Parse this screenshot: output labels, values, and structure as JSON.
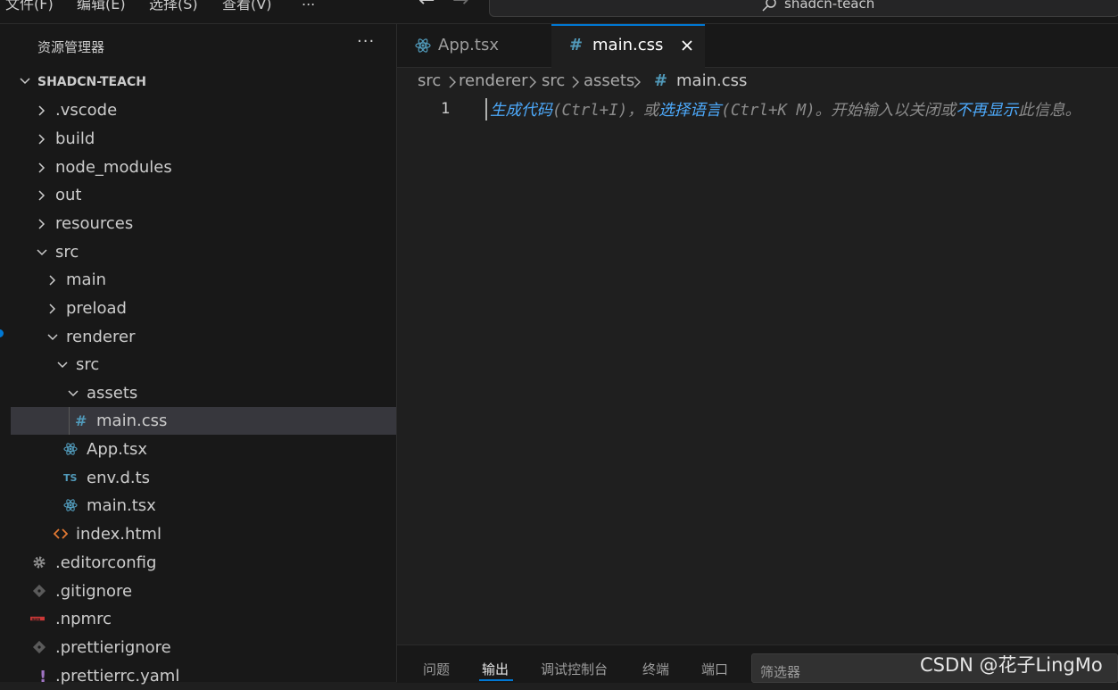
{
  "menu": [
    "文件(F)",
    "编辑(E)",
    "选择(S)",
    "查看(V)",
    "..."
  ],
  "command_center": {
    "text": "shadcn-teach"
  },
  "sidebar": {
    "title": "资源管理器",
    "more": "···",
    "root": "SHADCN-TEACH",
    "tree": [
      {
        "label": ".vscode",
        "type": "folder",
        "expanded": false
      },
      {
        "label": "build",
        "type": "folder",
        "expanded": false
      },
      {
        "label": "node_modules",
        "type": "folder",
        "expanded": false
      },
      {
        "label": "out",
        "type": "folder",
        "expanded": false
      },
      {
        "label": "resources",
        "type": "folder",
        "expanded": false
      },
      {
        "label": "src",
        "type": "folder",
        "expanded": true
      },
      {
        "label": "main",
        "type": "folder",
        "expanded": false
      },
      {
        "label": "preload",
        "type": "folder",
        "expanded": false
      },
      {
        "label": "renderer",
        "type": "folder",
        "expanded": true
      },
      {
        "label": "src",
        "type": "folder",
        "expanded": true
      },
      {
        "label": "assets",
        "type": "folder",
        "expanded": true
      },
      {
        "label": "main.css",
        "type": "css",
        "selected": true
      },
      {
        "label": "App.tsx",
        "type": "react"
      },
      {
        "label": "env.d.ts",
        "type": "ts",
        "badge": "TS"
      },
      {
        "label": "main.tsx",
        "type": "react"
      },
      {
        "label": "index.html",
        "type": "html"
      },
      {
        "label": ".editorconfig",
        "type": "gear"
      },
      {
        "label": ".gitignore",
        "type": "git"
      },
      {
        "label": ".npmrc",
        "type": "npm",
        "badge": "npm"
      },
      {
        "label": ".prettierignore",
        "type": "git"
      },
      {
        "label": ".prettierrc.yaml",
        "type": "yaml",
        "badge": "!"
      }
    ]
  },
  "tabs": [
    {
      "label": "App.tsx",
      "active": false
    },
    {
      "label": "main.css",
      "active": true,
      "icon": "#"
    }
  ],
  "breadcrumb": [
    "src",
    "renderer",
    "src",
    "assets",
    "main.css"
  ],
  "breadcrumb_icon": "#",
  "editor": {
    "line_number": "1",
    "hint": [
      {
        "text": "生成代码",
        "link": true
      },
      {
        "text": "(Ctrl+I)，或",
        "link": false
      },
      {
        "text": "选择语言",
        "link": true
      },
      {
        "text": "(Ctrl+K M)。开始输入以关闭或",
        "link": false
      },
      {
        "text": "不再显示",
        "link": true
      },
      {
        "text": "此信息。",
        "link": false
      }
    ]
  },
  "panel": {
    "tabs": [
      "问题",
      "输出",
      "调试控制台",
      "终端",
      "端口"
    ],
    "active_tab": "输出",
    "filter_placeholder": "筛选器"
  },
  "watermark": "CSDN @花子LingMo",
  "colors": {
    "accent": "#0078d4",
    "link": "#4daafc",
    "css_icon": "#519aba",
    "react_icon": "#519aba",
    "html_icon": "#e37933",
    "npm_badge": "#cb3837",
    "yaml_badge": "#a074c4"
  }
}
